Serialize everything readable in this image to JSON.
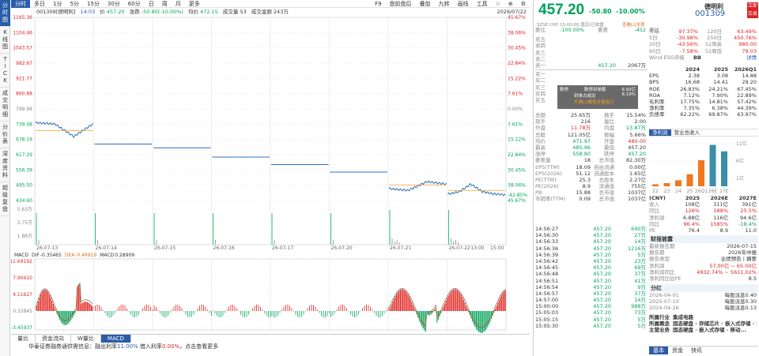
{
  "left_tabs": [
    "分时图",
    "K线图",
    "TICK",
    "成交明细",
    "分价表",
    "深度资料",
    "超级复盘"
  ],
  "toolbar": {
    "tabs": [
      "分时",
      "多日",
      "1分",
      "5分",
      "15分",
      "30分",
      "60分",
      "日",
      "周",
      "月",
      "更多"
    ],
    "right": [
      "F9",
      "盘前盘后",
      "叠加",
      "九转",
      "画线",
      "工具",
      "☆",
      "⊕",
      "⚙"
    ]
  },
  "info_bar": {
    "code_name": "001309[德明利]",
    "time": "14:03",
    "price_label": "价",
    "price": "457.20",
    "chg_label": "涨跌",
    "chg": "-50.80(-10.00%)",
    "avg_label": "均价",
    "avg": "472.15",
    "vol_label": "成交量",
    "vol": "53",
    "amt_label": "成交金额",
    "amt": "243万",
    "date": "2026/07/22"
  },
  "chart_data": {
    "type": "line",
    "left_axis": [
      "1165.36",
      "1104.46",
      "1043.57",
      "982.67",
      "921.77",
      "860.88",
      "799.98",
      "739.08",
      "678.19",
      "617.29",
      "556.39",
      "495.50",
      "434.60"
    ],
    "right_axis": [
      "45.67%",
      "38.06%",
      "30.45%",
      "22.84%",
      "15.22%",
      "7.61%",
      "0.00%",
      "7.61%",
      "15.22%",
      "22.84%",
      "30.45%",
      "38.06%",
      "45.67%"
    ],
    "vol_axis": [
      "5.63万",
      "3.75万",
      "1.88万"
    ],
    "dates": [
      "26-07-13",
      "26-07-14",
      "26-07-15",
      "26-07-16",
      "26-07-17",
      "26-07-20",
      "26-07-21",
      "26-07-22"
    ],
    "time_labels": [
      "13:00",
      "15:00"
    ],
    "last_pct": "-42.85%",
    "day_prices": [
      [
        745,
        740,
        690,
        740
      ],
      [
        660,
        660,
        660
      ],
      [
        645,
        645,
        645
      ],
      [
        608,
        608,
        608
      ],
      [
        578,
        578,
        578
      ],
      [
        548,
        548,
        548
      ],
      [
        482,
        475,
        510,
        500
      ],
      [
        460,
        470,
        500,
        470,
        461,
        457
      ]
    ],
    "macd_label": "MACD",
    "macd_dif_label": "DIF",
    "macd_dif": "-0.35465",
    "macd_dea_label": "DEA",
    "macd_dea": "-0.49919",
    "macd_val_label": "MACD",
    "macd_val": "0.28909",
    "macd_axis": [
      "11.69192",
      "7.90410",
      "4.11627",
      "0.32845",
      "-3.45937"
    ]
  },
  "bottom_tabs": [
    "量比",
    "资金流向",
    "W量比",
    "MACD"
  ],
  "status": {
    "prefix": "华泰证券融券通供需信息：融出利率",
    "rate": "11.00%",
    "mid": "  借入利率",
    "rate2": "0.00%",
    "suffix": "，点击查看更多"
  },
  "quote": {
    "price": "457.20",
    "chg": "-50.80",
    "pct": "-10.00%",
    "name": "德明利",
    "code": "001309",
    "btn": "立即交易",
    "sub": "SZSE  CNY  15:00:00  盘后/已收盘",
    "sub2": "查看L2全景"
  },
  "weibi": {
    "label": "委比",
    "value": "-100.00%",
    "label2": "委差",
    "value2": "-452"
  },
  "sell": [
    {
      "n": "卖五",
      "p": "",
      "v": ""
    },
    {
      "n": "卖四",
      "p": "",
      "v": ""
    },
    {
      "n": "卖三",
      "p": "",
      "v": ""
    },
    {
      "n": "卖二",
      "p": "",
      "v": ""
    },
    {
      "n": "卖一",
      "p": "457.20",
      "v": "2067万"
    }
  ],
  "buy": [
    {
      "n": "买一",
      "p": "",
      "v": ""
    },
    {
      "n": "买二",
      "p": "",
      "v": ""
    },
    {
      "n": "买三",
      "p": "",
      "v": ""
    },
    {
      "n": "买四",
      "p": "",
      "v": ""
    },
    {
      "n": "买五",
      "p": "",
      "v": ""
    }
  ],
  "popup": {
    "r1l": "跌停",
    "r1m": "跌停封单额",
    "r1v": "9.92亿",
    "r2m": "封单占成交",
    "r2v": "8.19%",
    "r3": "开通L2解锁全量盘口"
  },
  "stats": [
    [
      "总额",
      "25.65万",
      "换手",
      "15.54%"
    ],
    [
      "现手",
      "216",
      "量比",
      "2.00"
    ],
    [
      "外盘",
      "11.78万",
      "内盘",
      "13.87万"
    ],
    [
      "总股",
      "121.05亿",
      "振幅",
      "5.66%"
    ],
    [
      "均价",
      "471.97",
      "开盘",
      "480.00"
    ],
    [
      "最高",
      "485.96",
      "最低",
      "457.20"
    ],
    [
      "涨停",
      "558.80",
      "跌停",
      "457.20"
    ],
    [
      "委差量",
      "18",
      "总市值",
      "82.30万"
    ],
    [
      "EPS(TTM)",
      "18.09",
      "自由流通",
      "0.00亿"
    ],
    [
      "EPS(2026)",
      "51.12",
      "流通股本",
      "1.65亿"
    ],
    [
      "PE(TTM)",
      "25.3",
      "总股本",
      "2.27亿"
    ],
    [
      "PE(2026)",
      "8.9",
      "流通值",
      "755亿"
    ],
    [
      "PB",
      "15.88",
      "总市值",
      "1037亿"
    ],
    [
      "市销率(TTM)",
      "0.09",
      "总市值",
      "1037亿"
    ]
  ],
  "ticks": [
    [
      "14:56:27",
      "457.20",
      "690万"
    ],
    [
      "14:56:30",
      "457.20",
      "27万"
    ],
    [
      "14:56:33",
      "457.20",
      "14万"
    ],
    [
      "14:56:36",
      "457.20",
      "1216万"
    ],
    [
      "14:56:39",
      "457.20",
      "5万"
    ],
    [
      "14:56:42",
      "457.20",
      "23万"
    ],
    [
      "14:56:45",
      "457.20",
      "69万"
    ],
    [
      "14:56:48",
      "457.20",
      "37万"
    ],
    [
      "14:56:51",
      "457.20",
      "41万"
    ],
    [
      "14:56:54",
      "457.20",
      "9万"
    ],
    [
      "14:56:57",
      "457.20",
      "37万"
    ],
    [
      "14:57:00",
      "457.20",
      "14万"
    ],
    [
      "15:00:00",
      "457.20",
      "988万"
    ],
    [
      "15:05:03",
      "457.20",
      "73万"
    ],
    [
      "15:05:15",
      "457.20",
      "5万"
    ],
    [
      "15:05:30",
      "457.20",
      "5万"
    ]
  ],
  "perf": {
    "rows": [
      [
        "今年",
        "97.37%",
        "120日",
        "63.49%"
      ],
      [
        "5日",
        "-30.98%",
        "250日",
        "450.76%"
      ],
      [
        "20日",
        "-43.56%",
        "52周高",
        "980.00"
      ],
      [
        "60日",
        "-7.58%",
        "52周低",
        "79.03"
      ]
    ],
    "wind_label": "Wind ESG评级",
    "wind_val": "BB",
    "detail": "详情"
  },
  "fin": {
    "years": [
      "2024",
      "2025",
      "2026Q1"
    ],
    "rows": [
      [
        "EPS",
        "2.38",
        "3.08",
        "14.88"
      ],
      [
        "BPS",
        "16.68",
        "14.41",
        "29.20"
      ],
      [
        "ROE",
        "26.83%",
        "24.21%",
        "67.45%"
      ],
      [
        "ROA",
        "7.12%",
        "7.90%",
        "22.89%"
      ],
      [
        "毛利率",
        "17.75%",
        "14.81%",
        "57.42%"
      ],
      [
        "净利率",
        "7.35%",
        "6.38%",
        "44.39%"
      ],
      [
        "负债率",
        "62.22%",
        "69.87%",
        "63.97%"
      ]
    ]
  },
  "rev_tabs": [
    "净利润",
    "营业总收入"
  ],
  "rev_chart": {
    "y_axis": [
      "11亿",
      "6亿",
      "1亿"
    ],
    "x_axis": [
      "22",
      "23",
      "24",
      "25",
      "26Q1",
      "26E",
      "27E"
    ],
    "values": [
      0.5,
      0.8,
      1.5,
      3.0,
      6.5,
      10.3,
      8.7
    ]
  },
  "forecast": {
    "cols": [
      "(CNY)",
      "2025",
      "2026E",
      "2027E"
    ],
    "rows": [
      [
        "收入",
        "108亿",
        "311亿",
        "391亿"
      ],
      [
        "同比",
        "126%",
        "188%",
        "25.5%"
      ],
      [
        "净利润",
        "6.88亿",
        "116亿",
        "94.6亿"
      ],
      [
        "同比",
        "96.4%",
        "1585%",
        "-18.4%"
      ],
      [
        "PE",
        "76.4",
        "8.9",
        "11.0"
      ]
    ]
  },
  "report": {
    "title": "财报披露",
    "rows": [
      [
        "最新报告期",
        "2026-07-15"
      ],
      [
        "报告期",
        "2026年中报"
      ],
      [
        "报告类型",
        "业绩预告 | 摘要"
      ],
      [
        "净利润",
        "57.00亿 ~ 65.00亿"
      ],
      [
        "净利润同比",
        "4932.74% ~ 5611.02%"
      ],
      [
        "净利同比估PE",
        "8.5"
      ]
    ]
  },
  "dividend": {
    "title": "分红",
    "rows": [
      [
        "2026-04-01",
        "每股派息0.40"
      ],
      [
        "2025-07-10",
        "每股派息0.30"
      ],
      [
        "2024-04-26",
        "每股派息0.13"
      ]
    ]
  },
  "industry": [
    [
      "所属行业",
      "集成电路"
    ],
    [
      "所属概念",
      "固态硬盘 · 存储芯片 · 嵌入式存储 · 移动..."
    ],
    [
      "主营业务",
      "固态硬盘 · 嵌入式存储 · 移动..."
    ]
  ],
  "bottom_right_tabs": [
    "基本",
    "资金",
    "快讯"
  ]
}
